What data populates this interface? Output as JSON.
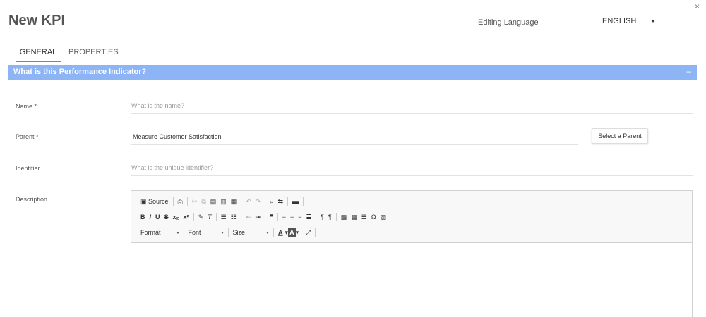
{
  "header": {
    "title": "New KPI",
    "close": "×"
  },
  "language": {
    "label": "Editing Language",
    "selected": "ENGLISH"
  },
  "tabs": [
    {
      "label": "GENERAL",
      "active": true
    },
    {
      "label": "PROPERTIES",
      "active": false
    }
  ],
  "section": {
    "title": "What is this Performance Indicator?",
    "toggle": "–",
    "color": "#8db4f5"
  },
  "form": {
    "name": {
      "label": "Name *",
      "placeholder": "What is the name?",
      "value": ""
    },
    "parent": {
      "label": "Parent *",
      "value": "Measure Customer Satisfaction",
      "button": "Select a Parent"
    },
    "identifier": {
      "label": "Identifier",
      "placeholder": "What is the unique identifier?",
      "value": ""
    },
    "description": {
      "label": "Description"
    }
  },
  "editor": {
    "source_label": "Source",
    "format_label": "Format",
    "font_label": "Font",
    "size_label": "Size",
    "bold": "B",
    "italic": "I",
    "underline": "U",
    "strike": "S",
    "subscript": "x₂",
    "superscript": "x²",
    "text_color": "A",
    "bg_color": "A"
  }
}
